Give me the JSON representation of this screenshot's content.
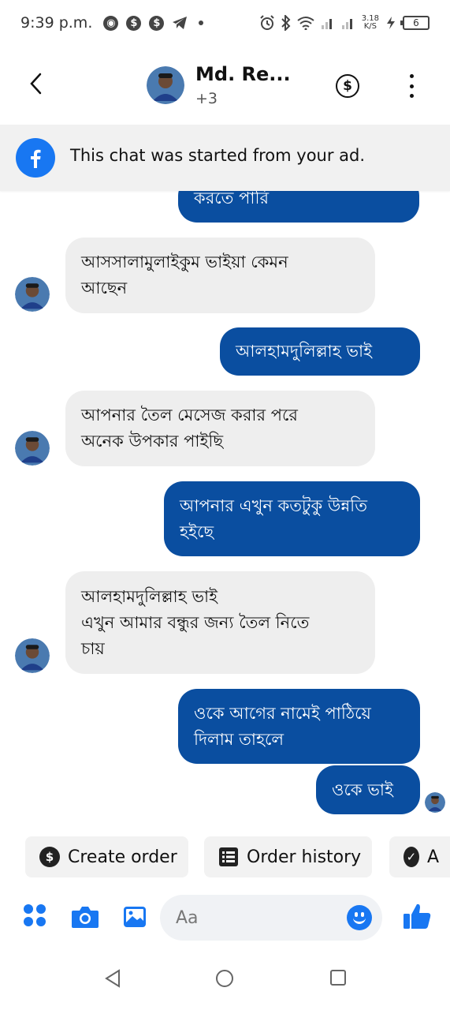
{
  "status_bar": {
    "time": "9:39 p.m.",
    "left_icons": [
      "chrome-icon",
      "dollar-icon",
      "dollar-icon",
      "telegram-icon",
      "dot-icon"
    ],
    "speed_value": "3.18",
    "speed_unit": "K/S",
    "battery": "6"
  },
  "header": {
    "back_icon": "chevron-left-icon",
    "name": "Md. Re...",
    "subtitle": "+3",
    "dollar_symbol": "$"
  },
  "ad_banner": {
    "text": "This chat was started from your ad."
  },
  "messages": [
    {
      "direction": "out",
      "lines": [
        "করতে পারি"
      ]
    },
    {
      "direction": "in",
      "lines": [
        "আসসালামুলাইকুম  ভাইয়া কেমন",
        "আছেন"
      ]
    },
    {
      "direction": "out",
      "lines": [
        "আলহামদুলিল্লাহ  ভাই"
      ]
    },
    {
      "direction": "in",
      "lines": [
        "আপনার তৈল মেসেজ করার পরে",
        "অনেক উপকার পাইছি"
      ]
    },
    {
      "direction": "out",
      "lines": [
        "আপনার এখুন কতটুকু উন্নতি",
        "হইছে"
      ]
    },
    {
      "direction": "in",
      "lines": [
        "আলহামদুলিল্লাহ ভাই",
        "এখুন আমার বন্ধুর জন্য তৈল নিতে",
        "চায়"
      ]
    },
    {
      "direction": "out",
      "lines": [
        "ওকে আগের নামেই পাঠিয়ে",
        "দিলাম তাহলে"
      ]
    },
    {
      "direction": "out",
      "lines": [
        "ওকে ভাই"
      ]
    }
  ],
  "quick_actions": [
    {
      "icon": "dollar-circle-icon",
      "symbol": "$",
      "label": "Create order"
    },
    {
      "icon": "list-icon",
      "label": "Order history"
    },
    {
      "icon": "check-circle-icon",
      "symbol": "✓",
      "label": "A"
    }
  ],
  "composer": {
    "placeholder": "Aa"
  },
  "colors": {
    "accent": "#1877f2",
    "outgoing_bubble": "#0a4ea0",
    "incoming_bubble": "#eeeeee"
  }
}
